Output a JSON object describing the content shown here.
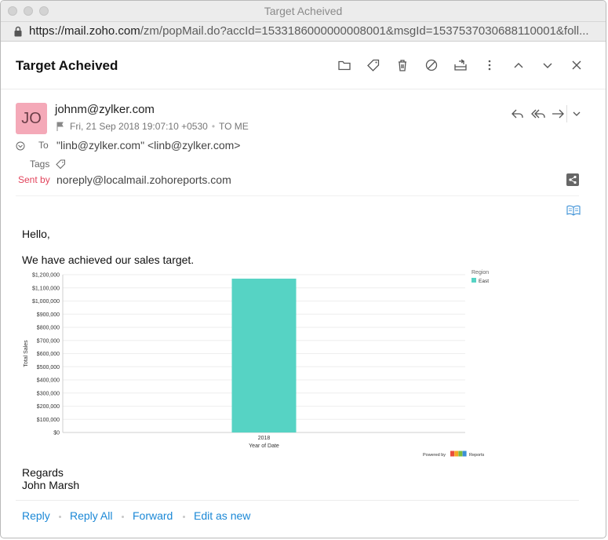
{
  "window": {
    "title": "Target Acheived",
    "url_host": "https://mail.zoho.com",
    "url_path": "/zm/popMail.do?accId=1533186000000008001&msgId=1537537030688110001&foll..."
  },
  "message": {
    "subject": "Target Acheived",
    "avatar_initials": "JO",
    "from": "johnm@zylker.com",
    "date": "Fri, 21 Sep 2018 19:07:10 +0530",
    "to_me": "TO ME",
    "to_label": "To",
    "to_value": "\"linb@zylker.com\" <linb@zylker.com>",
    "tags_label": "Tags",
    "sentby_label": "Sent by",
    "sentby_value": "noreply@localmail.zohoreports.com"
  },
  "body": {
    "greeting": "Hello,",
    "line1": "We have achieved our sales target.",
    "regards": "Regards",
    "signature": "John Marsh"
  },
  "footer": {
    "reply": "Reply",
    "reply_all": "Reply All",
    "forward": "Forward",
    "edit_as_new": "Edit as new"
  },
  "colors": {
    "bar": "#56d3c4",
    "avatar": "#f4a9b8",
    "link": "#1b88d6",
    "sentby_label": "#e2445c"
  },
  "chart_data": {
    "type": "bar",
    "categories": [
      "2018"
    ],
    "series": [
      {
        "name": "East",
        "values": [
          1170000
        ]
      }
    ],
    "xlabel": "Year of Date",
    "ylabel": "Total Sales",
    "ylim": [
      0,
      1200000
    ],
    "yticks": [
      "$0",
      "$100,000",
      "$200,000",
      "$300,000",
      "$400,000",
      "$500,000",
      "$600,000",
      "$700,000",
      "$800,000",
      "$900,000",
      "$1,000,000",
      "$1,100,000",
      "$1,200,000"
    ],
    "legend_title": "Region",
    "legend_position": "top-right",
    "grid": true,
    "powered_by": "Powered by",
    "brand": "Reports"
  }
}
